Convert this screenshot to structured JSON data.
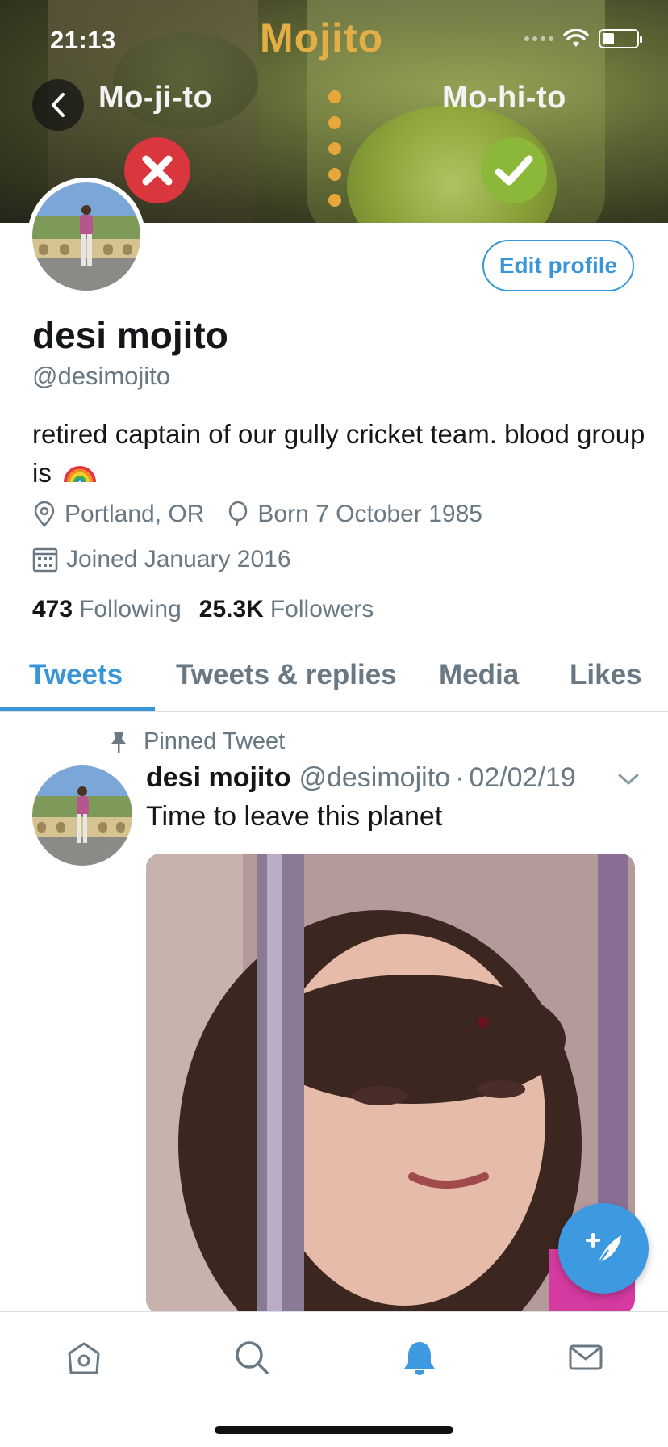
{
  "status_bar": {
    "time": "21:13"
  },
  "banner": {
    "brand": "Mojito",
    "label_left": "Mo-ji-to",
    "label_right": "Mo-hi-to"
  },
  "profile": {
    "edit_button": "Edit profile",
    "display_name": "desi mojito",
    "handle": "@desimojito",
    "bio": "retired captain of our gully cricket team. blood group is",
    "location": "Portland, OR",
    "birthday": "Born 7 October 1985",
    "joined": "Joined January 2016",
    "following_count": "473",
    "following_label": "Following",
    "followers_count": "25.3K",
    "followers_label": "Followers"
  },
  "tabs": {
    "items": [
      {
        "label": "Tweets",
        "active": true
      },
      {
        "label": "Tweets & replies",
        "active": false
      },
      {
        "label": "Media",
        "active": false
      },
      {
        "label": "Likes",
        "active": false
      }
    ]
  },
  "tweet": {
    "pinned_label": "Pinned Tweet",
    "author_name": "desi mojito",
    "author_handle": "@desimojito",
    "separator": "·",
    "date": "02/02/19",
    "text": "Time to leave this planet"
  },
  "bottom_nav": {
    "items": [
      "home-icon",
      "search-icon",
      "notifications-icon",
      "messages-icon"
    ],
    "active": "notifications-icon"
  },
  "colors": {
    "accent": "#3795d8",
    "brand_gold": "#e2ae45",
    "reject_red": "#d9363e",
    "accept_green": "#8cb83a",
    "muted_text": "#697883"
  }
}
